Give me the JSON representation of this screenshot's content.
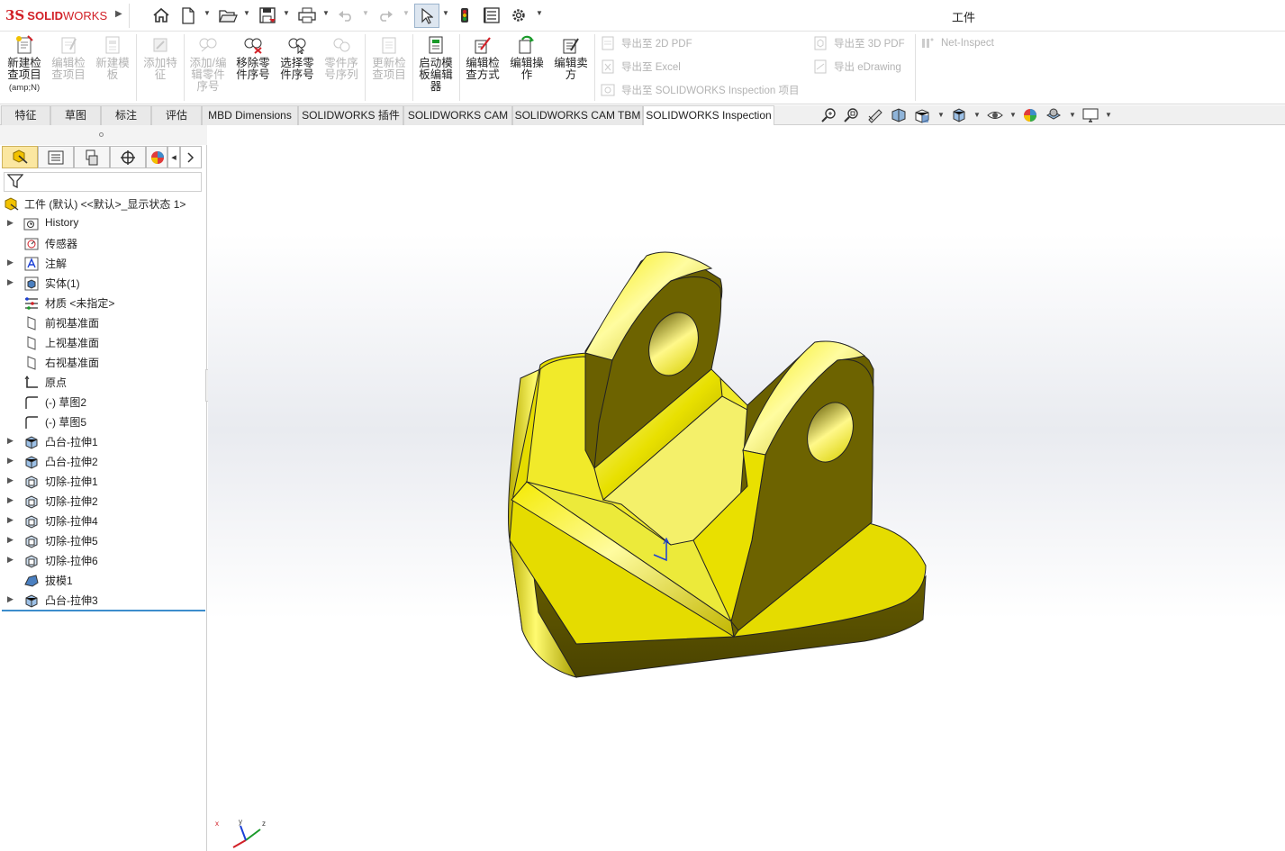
{
  "app": {
    "brand_ds": "3S",
    "brand_solid": "SOLID",
    "brand_works": "WORKS",
    "window_title": "工件"
  },
  "quick_access": {
    "icons": [
      "home-icon",
      "new-document-icon",
      "open-folder-icon",
      "save-icon",
      "print-icon",
      "undo-icon",
      "redo-icon",
      "select-cursor-icon",
      "rebuild-traffic-light-icon",
      "file-properties-icon",
      "options-gear-icon"
    ]
  },
  "ribbon": {
    "buttons": [
      {
        "label": "新建检查项目",
        "sub": "(amp;N)",
        "enabled": true
      },
      {
        "label": "编辑检查项目",
        "enabled": false
      },
      {
        "label": "新建模板",
        "enabled": false
      },
      {
        "label": "添加特征",
        "enabled": false
      },
      {
        "label": "添加/编辑零件序号",
        "enabled": false
      },
      {
        "label": "移除零件序号",
        "enabled": true
      },
      {
        "label": "选择零件序号",
        "enabled": true
      },
      {
        "label": "零件序号序列",
        "enabled": false
      },
      {
        "label": "更新检查项目",
        "enabled": false
      },
      {
        "label": "启动模板编辑器",
        "enabled": true
      },
      {
        "label": "编辑检查方式",
        "enabled": true
      },
      {
        "label": "编辑操作",
        "enabled": true
      },
      {
        "label": "编辑卖方",
        "enabled": true
      }
    ],
    "small": {
      "export_2d_pdf": "导出至 2D PDF",
      "export_excel": "导出至 Excel",
      "export_inspection": "导出至 SOLIDWORKS Inspection 项目",
      "export_3d_pdf": "导出至 3D PDF",
      "export_edrawing": "导出 eDrawing",
      "net_inspect": "Net-Inspect"
    }
  },
  "tabs": [
    "特征",
    "草图",
    "标注",
    "评估",
    "MBD Dimensions",
    "SOLIDWORKS 插件",
    "SOLIDWORKS CAM",
    "SOLIDWORKS CAM TBM",
    "SOLIDWORKS Inspection"
  ],
  "active_tab": "SOLIDWORKS Inspection",
  "view_toolbar": {
    "icons": [
      "zoom-to-fit-icon",
      "zoom-to-area-icon",
      "previous-view-icon",
      "section-view-icon",
      "view-orientation-icon",
      "display-style-icon",
      "hide-show-items-icon",
      "edit-appearance-icon",
      "apply-scene-icon",
      "view-settings-icon"
    ]
  },
  "panel": {
    "tabs": [
      "feature-manager-icon",
      "property-manager-icon",
      "configuration-manager-icon",
      "dimxpert-manager-icon",
      "display-manager-icon"
    ],
    "tree": [
      {
        "label": "工件 (默认) <<默认>_显示状态 1>",
        "icon": "part-icon",
        "expand": false,
        "root": true
      },
      {
        "label": "History",
        "icon": "history-icon",
        "expand": true
      },
      {
        "label": "传感器",
        "icon": "sensor-icon",
        "expand": false
      },
      {
        "label": "注解",
        "icon": "annotation-icon",
        "expand": true
      },
      {
        "label": "实体(1)",
        "icon": "solid-bodies-icon",
        "expand": true
      },
      {
        "label": "材质 <未指定>",
        "icon": "material-icon",
        "expand": false
      },
      {
        "label": "前视基准面",
        "icon": "plane-icon",
        "expand": false
      },
      {
        "label": "上视基准面",
        "icon": "plane-icon",
        "expand": false
      },
      {
        "label": "右视基准面",
        "icon": "plane-icon",
        "expand": false
      },
      {
        "label": "原点",
        "icon": "origin-icon",
        "expand": false
      },
      {
        "label": "(-) 草图2",
        "icon": "sketch-icon",
        "expand": false
      },
      {
        "label": "(-) 草图5",
        "icon": "sketch-icon",
        "expand": false
      },
      {
        "label": "凸台-拉伸1",
        "icon": "boss-extrude-icon",
        "expand": true
      },
      {
        "label": "凸台-拉伸2",
        "icon": "boss-extrude-icon",
        "expand": true
      },
      {
        "label": "切除-拉伸1",
        "icon": "cut-extrude-icon",
        "expand": true
      },
      {
        "label": "切除-拉伸2",
        "icon": "cut-extrude-icon",
        "expand": true
      },
      {
        "label": "切除-拉伸4",
        "icon": "cut-extrude-icon",
        "expand": true
      },
      {
        "label": "切除-拉伸5",
        "icon": "cut-extrude-icon",
        "expand": true
      },
      {
        "label": "切除-拉伸6",
        "icon": "cut-extrude-icon",
        "expand": true
      },
      {
        "label": "拔模1",
        "icon": "draft-icon",
        "expand": false
      },
      {
        "label": "凸台-拉伸3",
        "icon": "boss-extrude-icon",
        "expand": true
      }
    ]
  },
  "colors": {
    "brand_red": "#d22027",
    "part_yellow": "#e6e000",
    "selection_blue": "#3c8dcc",
    "tab_active_bg": "#fbe7a1"
  }
}
